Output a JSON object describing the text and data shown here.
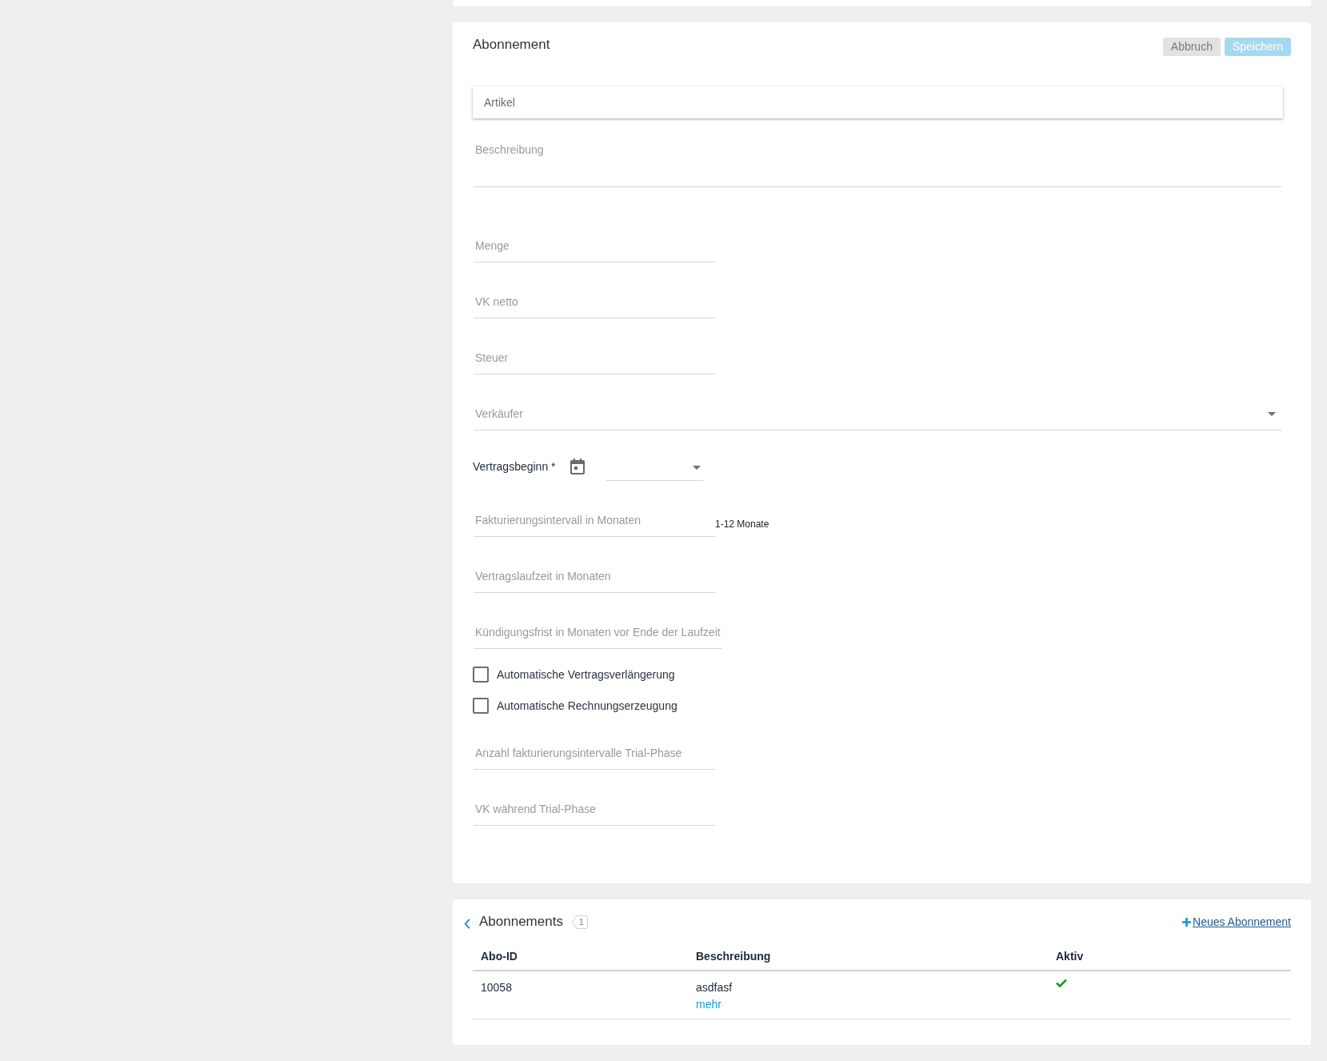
{
  "subscription_form": {
    "title": "Abonnement",
    "buttons": [
      {
        "label": "Abbruch",
        "kind": "secondary",
        "disabled": false
      },
      {
        "label": "Speichern",
        "kind": "primary",
        "disabled": true
      }
    ],
    "fields": [
      {
        "kind": "search",
        "placeholder": "Artikel"
      },
      {
        "kind": "textarea",
        "placeholder": "Beschreibung"
      },
      {
        "kind": "text",
        "placeholder": "Menge"
      },
      {
        "kind": "text",
        "placeholder": "VK netto"
      },
      {
        "kind": "text",
        "placeholder": "Steuer"
      },
      {
        "kind": "select",
        "placeholder": "Verkäufer"
      },
      {
        "kind": "date",
        "label": "Vertragsbeginn *"
      },
      {
        "kind": "text",
        "placeholder": "Fakturierungsintervall in Monaten",
        "hint": "1-12 Monate"
      },
      {
        "kind": "text",
        "placeholder": "Vertragslaufzeit in Monaten"
      },
      {
        "kind": "text",
        "placeholder": "Kündigungsfrist in Monaten vor Ende der Laufzeit"
      },
      {
        "kind": "checkbox",
        "label": "Automatische Vertragsverlängerung",
        "checked": false
      },
      {
        "kind": "checkbox",
        "label": "Automatische Rechnungserzeugung",
        "checked": false
      },
      {
        "kind": "text",
        "placeholder": "Anzahl fakturierungsintervalle Trial-Phase"
      },
      {
        "kind": "text",
        "placeholder": "VK während Trial-Phase"
      }
    ]
  },
  "subscriptions": {
    "title": "Abonnements",
    "count": "1",
    "new_link": "Neues Abonnement",
    "table": {
      "columns": [
        "Abo-ID",
        "Beschreibung",
        "Aktiv"
      ],
      "rows": [
        {
          "abo_id": "10058",
          "description": "asdfasf",
          "more_link": "mehr",
          "active": true
        }
      ]
    }
  }
}
